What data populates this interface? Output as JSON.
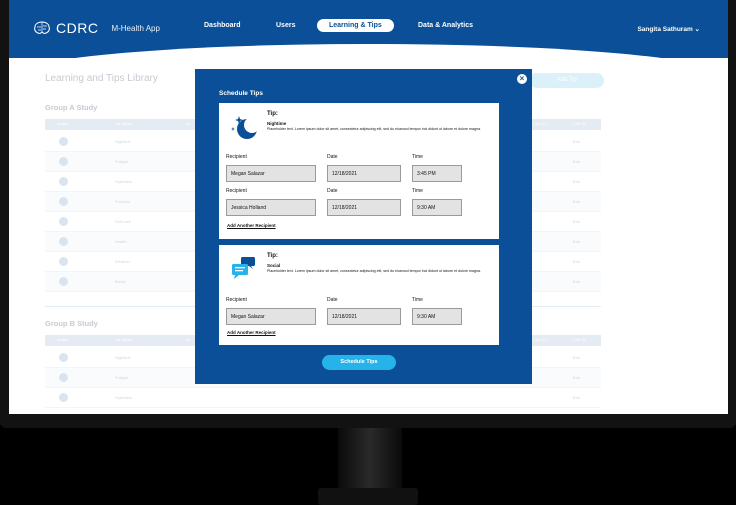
{
  "header": {
    "logo": "CDRC",
    "app_name": "M-Health App",
    "nav": [
      "Dashboard",
      "Users",
      "Learning & Tips",
      "Data & Analytics"
    ],
    "user": "Sangita Sathuram"
  },
  "background": {
    "page_title": "Learning and Tips Library",
    "add_button": "Add Tip",
    "group_a": "Group A Study",
    "group_b": "Group B Study",
    "columns": [
      "Image",
      "Tip Name",
      "Tip",
      "Last Ed",
      "Edit Tip"
    ],
    "rows_a": [
      "Nightime",
      "Fatigue",
      "Hydration",
      "Exercise",
      "Self-care",
      "Health",
      "Weather",
      "Break"
    ],
    "rows_b": [
      "Nightime",
      "Fatigue",
      "Hydration"
    ],
    "edit": "Edit"
  },
  "modal": {
    "title": "Schedule Tips",
    "close": "×",
    "tip_label": "Tip:",
    "lorem": "Placeholder text. Lorem ipsum dolor sit amet, consectetur adipiscing elit, sed do eiusmod tempor inci didunt ut labore et dolore magna.",
    "recipient_label": "Recipient",
    "date_label": "Date",
    "time_label": "Time",
    "add_recipient": "Add Another Recipient",
    "tips": [
      {
        "name": "Nightime",
        "icon": "moon-stars-icon",
        "rows": [
          {
            "recipient": "Megan Salazar",
            "date": "12/18/2021",
            "time": "3:45 PM"
          },
          {
            "recipient": "Jessica Holland",
            "date": "12/18/2021",
            "time": "9:30 AM"
          }
        ]
      },
      {
        "name": "Social",
        "icon": "chat-bubbles-icon",
        "rows": [
          {
            "recipient": "Megan Salazar",
            "date": "12/18/2021",
            "time": "9:30 AM"
          }
        ]
      }
    ],
    "submit": "Schedule Tips"
  },
  "colors": {
    "primary": "#0a4f97",
    "accent": "#26b3ea",
    "field": "#e3e3e3"
  }
}
